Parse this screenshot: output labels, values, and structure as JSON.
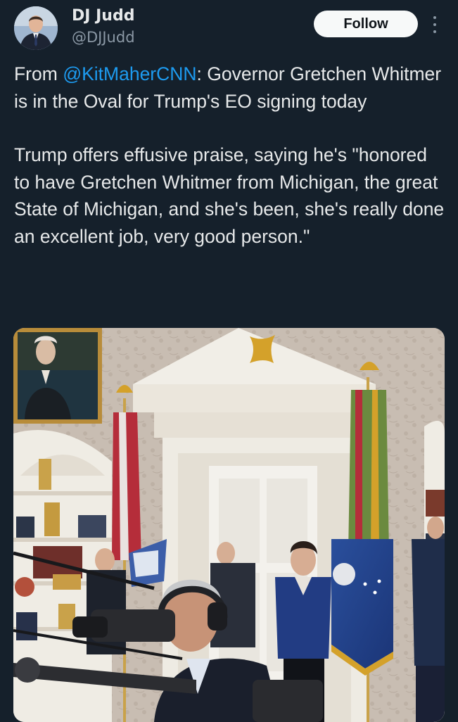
{
  "author": {
    "display_name": "DJ Judd",
    "handle": "@DJJudd"
  },
  "actions": {
    "follow_label": "Follow",
    "more_icon": "more-vertical-icon"
  },
  "tweet": {
    "prefix": "From ",
    "mention": "@KitMaherCNN",
    "paragraph1_rest": ": Governor Gretchen Whitmer is in the Oval for Trump's EO signing today",
    "paragraph2": "Trump offers effusive praise, saying he's \"honored to have Gretchen Whitmer from Michigan, the great State of Michigan, and she's been, she's really done an excellent job, very good person.\""
  },
  "colors": {
    "background": "#15202b",
    "text": "#e7e9ea",
    "secondary_text": "#8b98a5",
    "mention": "#1d9bf0",
    "follow_button_bg": "#f7f9f9"
  }
}
